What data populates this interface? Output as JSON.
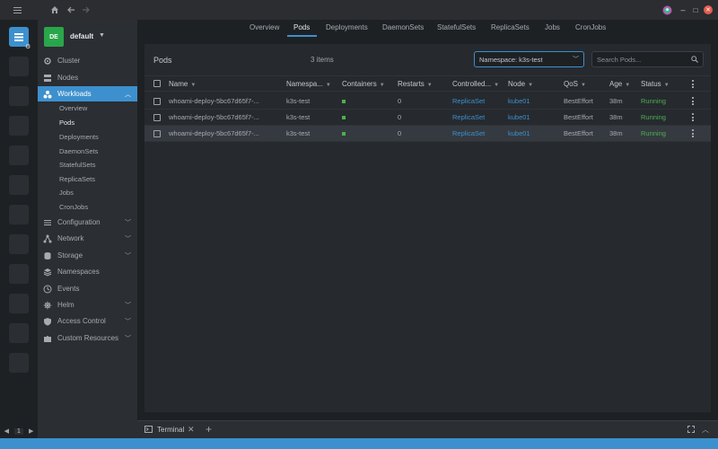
{
  "titlebar": {
    "menu_icon": "hamburger-icon",
    "home_icon": "home-icon",
    "back_icon": "arrow-left-icon",
    "forward_icon": "arrow-right-icon",
    "minimize": "–",
    "maximize": "□",
    "close": "✕"
  },
  "hotbar": {
    "page": "1",
    "prev": "◀",
    "next": "▶"
  },
  "sidebar": {
    "cluster_avatar": "DE",
    "cluster_name": "default",
    "items": [
      {
        "label": "Cluster",
        "icon": "cluster-icon"
      },
      {
        "label": "Nodes",
        "icon": "nodes-icon"
      },
      {
        "label": "Workloads",
        "icon": "workloads-icon",
        "active": true,
        "expanded": true
      },
      {
        "label": "Configuration",
        "icon": "configuration-icon"
      },
      {
        "label": "Network",
        "icon": "network-icon"
      },
      {
        "label": "Storage",
        "icon": "storage-icon"
      },
      {
        "label": "Namespaces",
        "icon": "namespaces-icon"
      },
      {
        "label": "Events",
        "icon": "events-icon"
      },
      {
        "label": "Helm",
        "icon": "helm-icon"
      },
      {
        "label": "Access Control",
        "icon": "access-control-icon"
      },
      {
        "label": "Custom Resources",
        "icon": "custom-resources-icon"
      }
    ],
    "workloads_sub": [
      "Overview",
      "Pods",
      "Deployments",
      "DaemonSets",
      "StatefulSets",
      "ReplicaSets",
      "Jobs",
      "CronJobs"
    ]
  },
  "tabs": [
    "Overview",
    "Pods",
    "Deployments",
    "DaemonSets",
    "StatefulSets",
    "ReplicaSets",
    "Jobs",
    "CronJobs"
  ],
  "pods": {
    "title": "Pods",
    "count": "3 items",
    "namespace_select": "Namespace: k3s-test",
    "search_placeholder": "Search Pods...",
    "columns": [
      "Name",
      "Namespa...",
      "Containers",
      "Restarts",
      "Controlled...",
      "Node",
      "QoS",
      "Age",
      "Status"
    ],
    "rows": [
      {
        "name": "whoami-deploy-5bc67d65f7-...",
        "namespace": "k3s-test",
        "restarts": "0",
        "controlled_by": "ReplicaSet",
        "node": "kube01",
        "qos": "BestEffort",
        "age": "38m",
        "status": "Running"
      },
      {
        "name": "whoami-deploy-5bc67d65f7-...",
        "namespace": "k3s-test",
        "restarts": "0",
        "controlled_by": "ReplicaSet",
        "node": "kube01",
        "qos": "BestEffort",
        "age": "38m",
        "status": "Running"
      },
      {
        "name": "whoami-deploy-5bc67d65f7-...",
        "namespace": "k3s-test",
        "restarts": "0",
        "controlled_by": "ReplicaSet",
        "node": "kube01",
        "qos": "BestEffort",
        "age": "38m",
        "status": "Running"
      }
    ]
  },
  "dock": {
    "terminal_label": "Terminal",
    "close": "✕",
    "add": "+"
  },
  "colors": {
    "accent": "#3d90ce",
    "running": "#4caf50",
    "avatar": "#2aa64a"
  }
}
